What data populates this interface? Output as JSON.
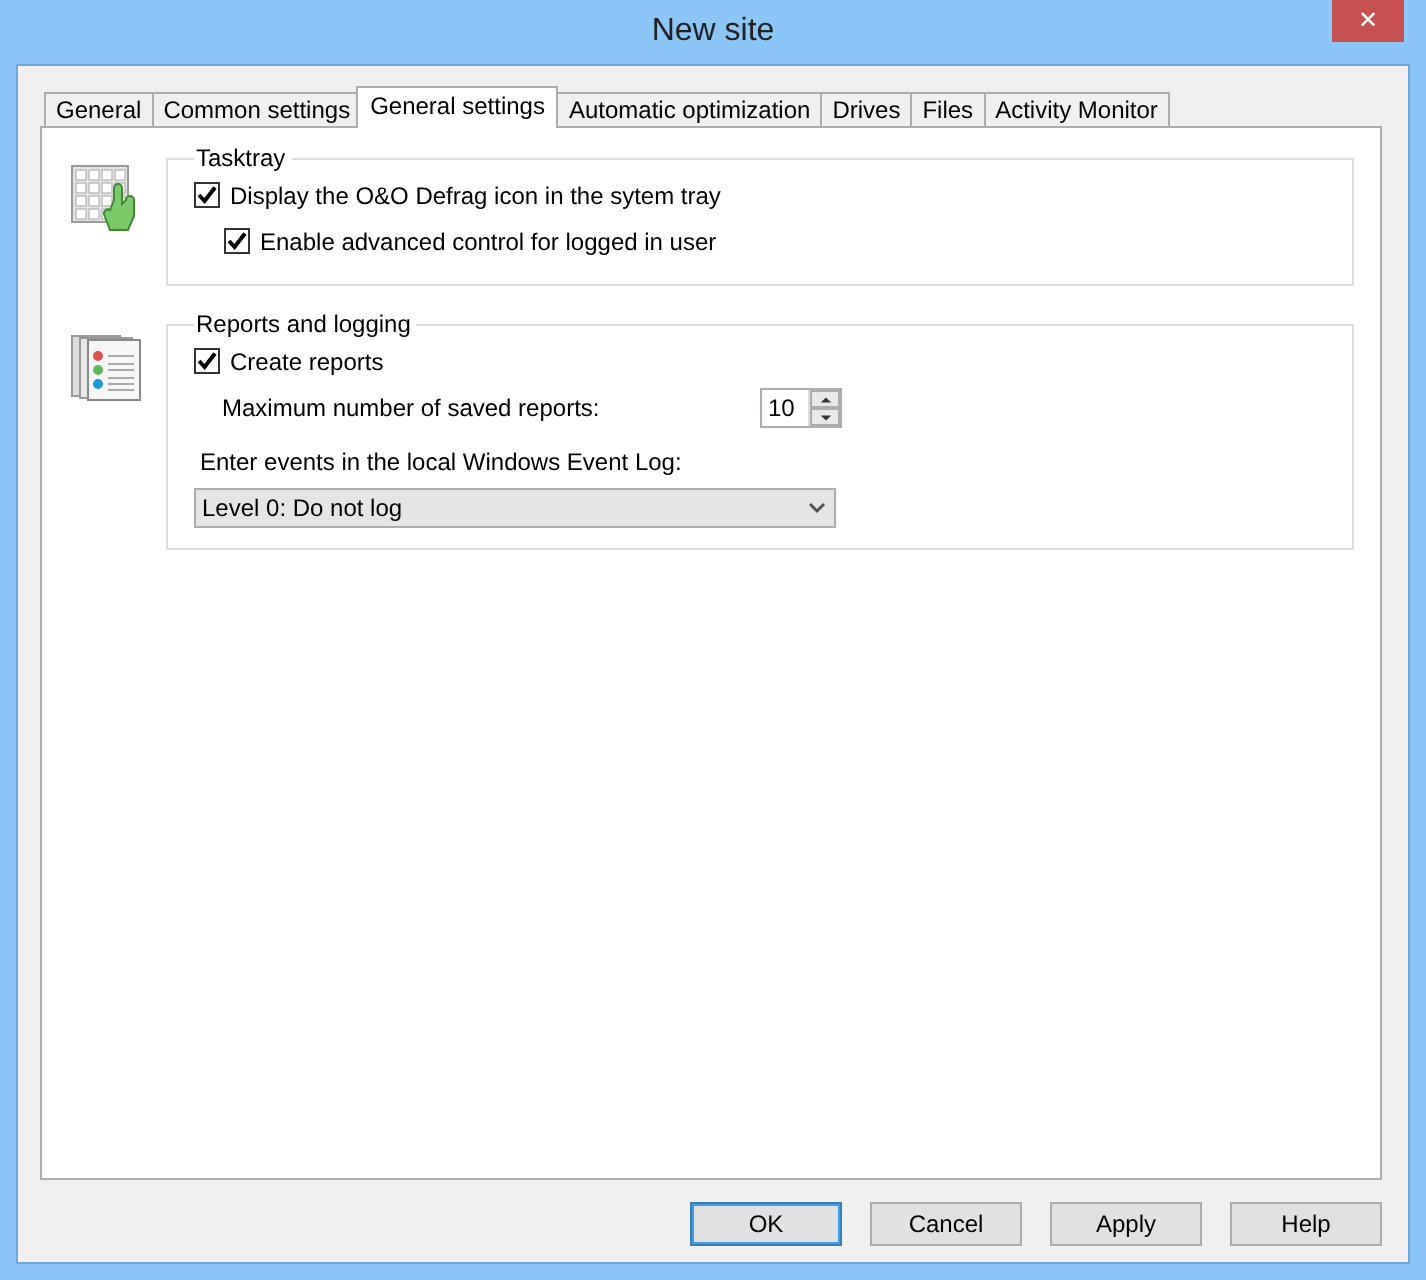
{
  "window": {
    "title": "New site",
    "close": "✕"
  },
  "tabs": [
    {
      "label": "General",
      "selected": false
    },
    {
      "label": "Common settings",
      "selected": false
    },
    {
      "label": "General settings",
      "selected": true
    },
    {
      "label": "Automatic optimization",
      "selected": false
    },
    {
      "label": "Drives",
      "selected": false
    },
    {
      "label": "Files",
      "selected": false
    },
    {
      "label": "Activity Monitor",
      "selected": false
    }
  ],
  "groups": [
    {
      "legend": "Tasktray",
      "items": [
        {
          "kind": "checkbox",
          "label": "Display the O&O Defrag icon in the sytem tray",
          "checked": true,
          "children": [
            {
              "kind": "checkbox",
              "label": "Enable advanced control for logged in user",
              "checked": true
            }
          ]
        }
      ]
    },
    {
      "legend": "Reports and logging",
      "items": [
        {
          "kind": "checkbox",
          "label": "Create reports",
          "checked": true
        },
        {
          "kind": "spinner",
          "label": "Maximum number of saved reports:",
          "value": "10"
        },
        {
          "kind": "dropdown",
          "label": "Enter events in the local Windows Event Log:",
          "value": "Level 0: Do not log"
        }
      ]
    }
  ],
  "buttons": [
    {
      "label": "OK",
      "default": true
    },
    {
      "label": "Cancel",
      "default": false
    },
    {
      "label": "Apply",
      "default": false
    },
    {
      "label": "Help",
      "default": false
    }
  ]
}
